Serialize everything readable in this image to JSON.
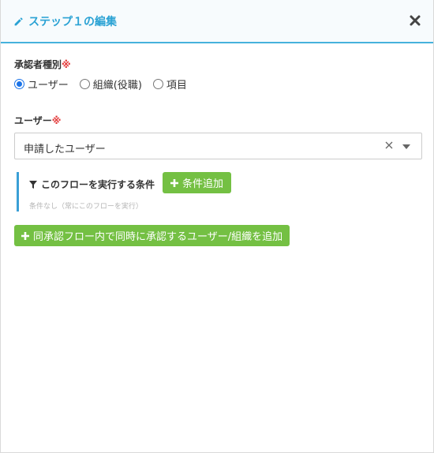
{
  "header": {
    "title": "ステップ１の編集",
    "pencil_icon": "pencil-icon",
    "close_icon": "close-icon",
    "accent_color": "#2aa2d4"
  },
  "approver_type": {
    "label": "承認者種別",
    "required_mark": "※",
    "options": [
      {
        "label": "ユーザー",
        "checked": true
      },
      {
        "label": "組織(役職)",
        "checked": false
      },
      {
        "label": "項目",
        "checked": false
      }
    ]
  },
  "user": {
    "label": "ユーザー",
    "required_mark": "※",
    "selected_value": "申請したユーザー",
    "clear_icon": "clear-icon",
    "arrow_icon": "chevron-down-icon"
  },
  "condition": {
    "title": "このフローを実行する条件",
    "filter_icon": "filter-icon",
    "add_button_label": "条件追加",
    "note": "条件なし（常にこのフローを実行）"
  },
  "add_same_time_button_label": "同承認フロー内で同時に承認するユーザー/組織を追加",
  "colors": {
    "button_green": "#74c043",
    "required_red": "#e33b3b",
    "condition_bar": "#3a9fd6"
  }
}
